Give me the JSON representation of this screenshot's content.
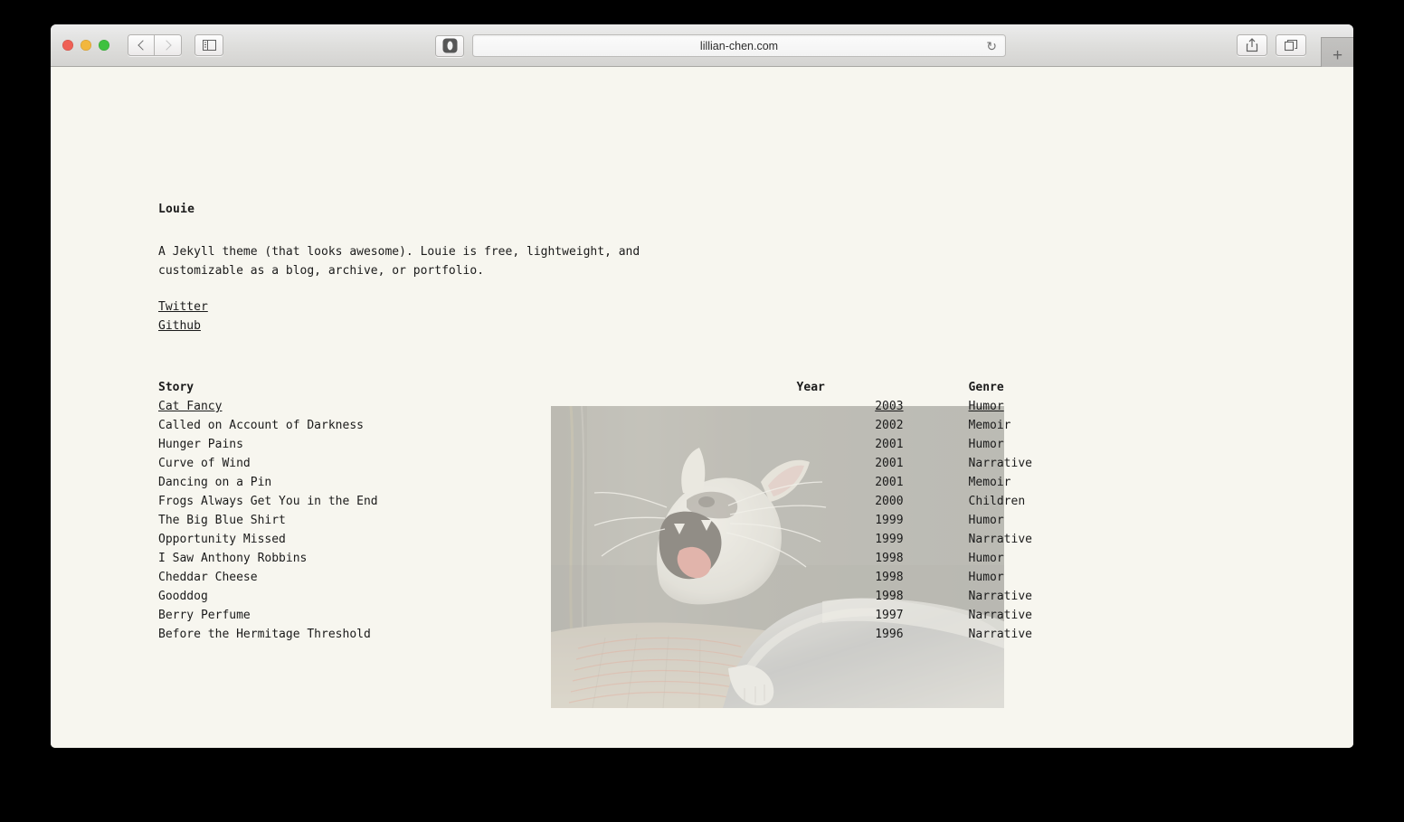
{
  "browser": {
    "url": "lillian-chen.com",
    "nav": {
      "back_label": "Back",
      "forward_label": "Forward"
    },
    "sidebar_toggle_label": "Show Sidebar",
    "shield_label": "Privacy Shield",
    "reload_label": "↻",
    "share_label": "Share",
    "tabs_label": "Show All Tabs",
    "newtab_label": "+"
  },
  "page": {
    "title": "Louie",
    "intro": "A Jekyll theme (that looks awesome). Louie is free, lightweight, and\ncustomizable as a blog, archive, or portfolio.",
    "links": [
      {
        "label": "Twitter"
      },
      {
        "label": "Github"
      }
    ],
    "table": {
      "headers": {
        "story": "Story",
        "year": "Year",
        "genre": "Genre"
      },
      "rows": [
        {
          "story": "Cat Fancy",
          "year": "2003",
          "genre": "Humor",
          "is_link": true,
          "active": true
        },
        {
          "story": "Called on Account of Darkness",
          "year": "2002",
          "genre": "Memoir",
          "is_link": false,
          "active": false
        },
        {
          "story": "Hunger Pains",
          "year": "2001",
          "genre": "Humor",
          "is_link": false,
          "active": false
        },
        {
          "story": "Curve of Wind",
          "year": "2001",
          "genre": "Narrative",
          "is_link": false,
          "active": false
        },
        {
          "story": "Dancing on a Pin",
          "year": "2001",
          "genre": "Memoir",
          "is_link": false,
          "active": false
        },
        {
          "story": "Frogs Always Get You in the End",
          "year": "2000",
          "genre": "Children",
          "is_link": false,
          "active": false
        },
        {
          "story": "The Big Blue Shirt",
          "year": "1999",
          "genre": "Humor",
          "is_link": false,
          "active": false
        },
        {
          "story": "Opportunity Missed",
          "year": "1999",
          "genre": "Narrative",
          "is_link": false,
          "active": false
        },
        {
          "story": "I Saw Anthony Robbins",
          "year": "1998",
          "genre": "Humor",
          "is_link": false,
          "active": false
        },
        {
          "story": "Cheddar Cheese",
          "year": "1998",
          "genre": "Humor",
          "is_link": false,
          "active": false
        },
        {
          "story": "Gooddog",
          "year": "1998",
          "genre": "Narrative",
          "is_link": false,
          "active": false
        },
        {
          "story": "Berry Perfume",
          "year": "1997",
          "genre": "Narrative",
          "is_link": false,
          "active": false
        },
        {
          "story": "Before the Hermitage Threshold",
          "year": "1996",
          "genre": "Narrative",
          "is_link": false,
          "active": false
        }
      ]
    },
    "photo": {
      "alt": "yawning white and grey cat lying on a striped blanket"
    }
  },
  "colors": {
    "page_background": "#f7f6ef",
    "text": "#1b1b1b",
    "toolbar": "#dededc",
    "traffic_red": "#ef6055",
    "traffic_yellow": "#f2b73e",
    "traffic_green": "#3ec13f"
  }
}
